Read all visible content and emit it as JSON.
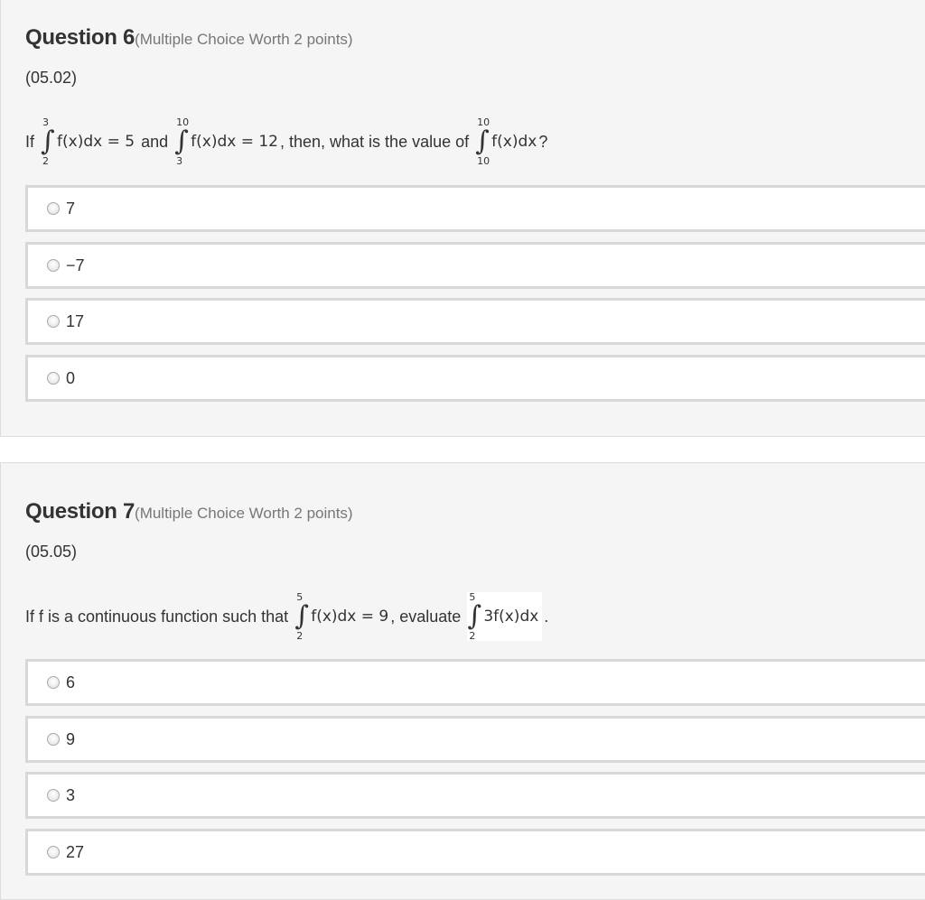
{
  "questions": [
    {
      "title": "Question 6",
      "worth": "(Multiple Choice Worth 2 points)",
      "code": "(05.02)",
      "prompt": {
        "t1": "If",
        "i1": {
          "upper": "3",
          "lower": "2",
          "body": "f(x)dx = 5"
        },
        "t2": "and",
        "i2": {
          "upper": "10",
          "lower": "3",
          "body": "f(x)dx = 12"
        },
        "t3": ", then, what is the value of",
        "i3": {
          "upper": "10",
          "lower": "10",
          "body": "f(x)dx"
        },
        "t4": "?"
      },
      "choices": [
        "7",
        "−7",
        "17",
        "0"
      ]
    },
    {
      "title": "Question 7",
      "worth": "(Multiple Choice Worth 2 points)",
      "code": "(05.05)",
      "prompt": {
        "t1": "If f is a continuous function such that",
        "i1": {
          "upper": "5",
          "lower": "2",
          "body": "f(x)dx = 9"
        },
        "t2": ", evaluate",
        "i2": {
          "upper": "5",
          "lower": "2",
          "body": "3f(x)dx"
        },
        "t3": "."
      },
      "choices": [
        "6",
        "9",
        "3",
        "27"
      ]
    }
  ],
  "icons": {
    "integral": "integral-sign",
    "radio": "radio-button-unselected"
  }
}
